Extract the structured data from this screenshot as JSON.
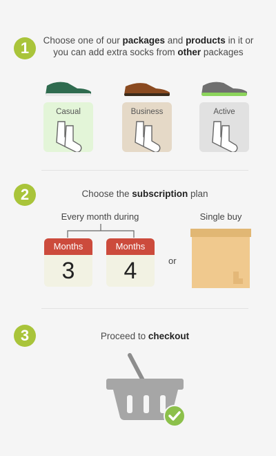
{
  "step1": {
    "number": "1",
    "text_parts": [
      "Choose one of our ",
      "packages",
      " and ",
      "products",
      " in it or you can add extra socks from ",
      "other",
      " packages"
    ],
    "packages": [
      {
        "label": "Casual",
        "card_color": "#e3f5d8"
      },
      {
        "label": "Business",
        "card_color": "#e5d9c7"
      },
      {
        "label": "Active",
        "card_color": "#e1e1e1"
      }
    ]
  },
  "step2": {
    "number": "2",
    "text_parts": [
      "Choose the ",
      "subscription",
      " plan"
    ],
    "every_month_label": "Every month during",
    "single_buy_label": "Single buy",
    "or_label": "or",
    "calendars": [
      {
        "top": "Months",
        "value": "3"
      },
      {
        "top": "Months",
        "value": "4"
      }
    ]
  },
  "step3": {
    "number": "3",
    "text_parts": [
      "Proceed to ",
      "checkout"
    ]
  },
  "colors": {
    "accent": "#a9c43a",
    "calendar_red": "#cc4b3c",
    "box": "#f0c98e",
    "basket": "#a6a6a6",
    "check": "#8cc04b"
  }
}
